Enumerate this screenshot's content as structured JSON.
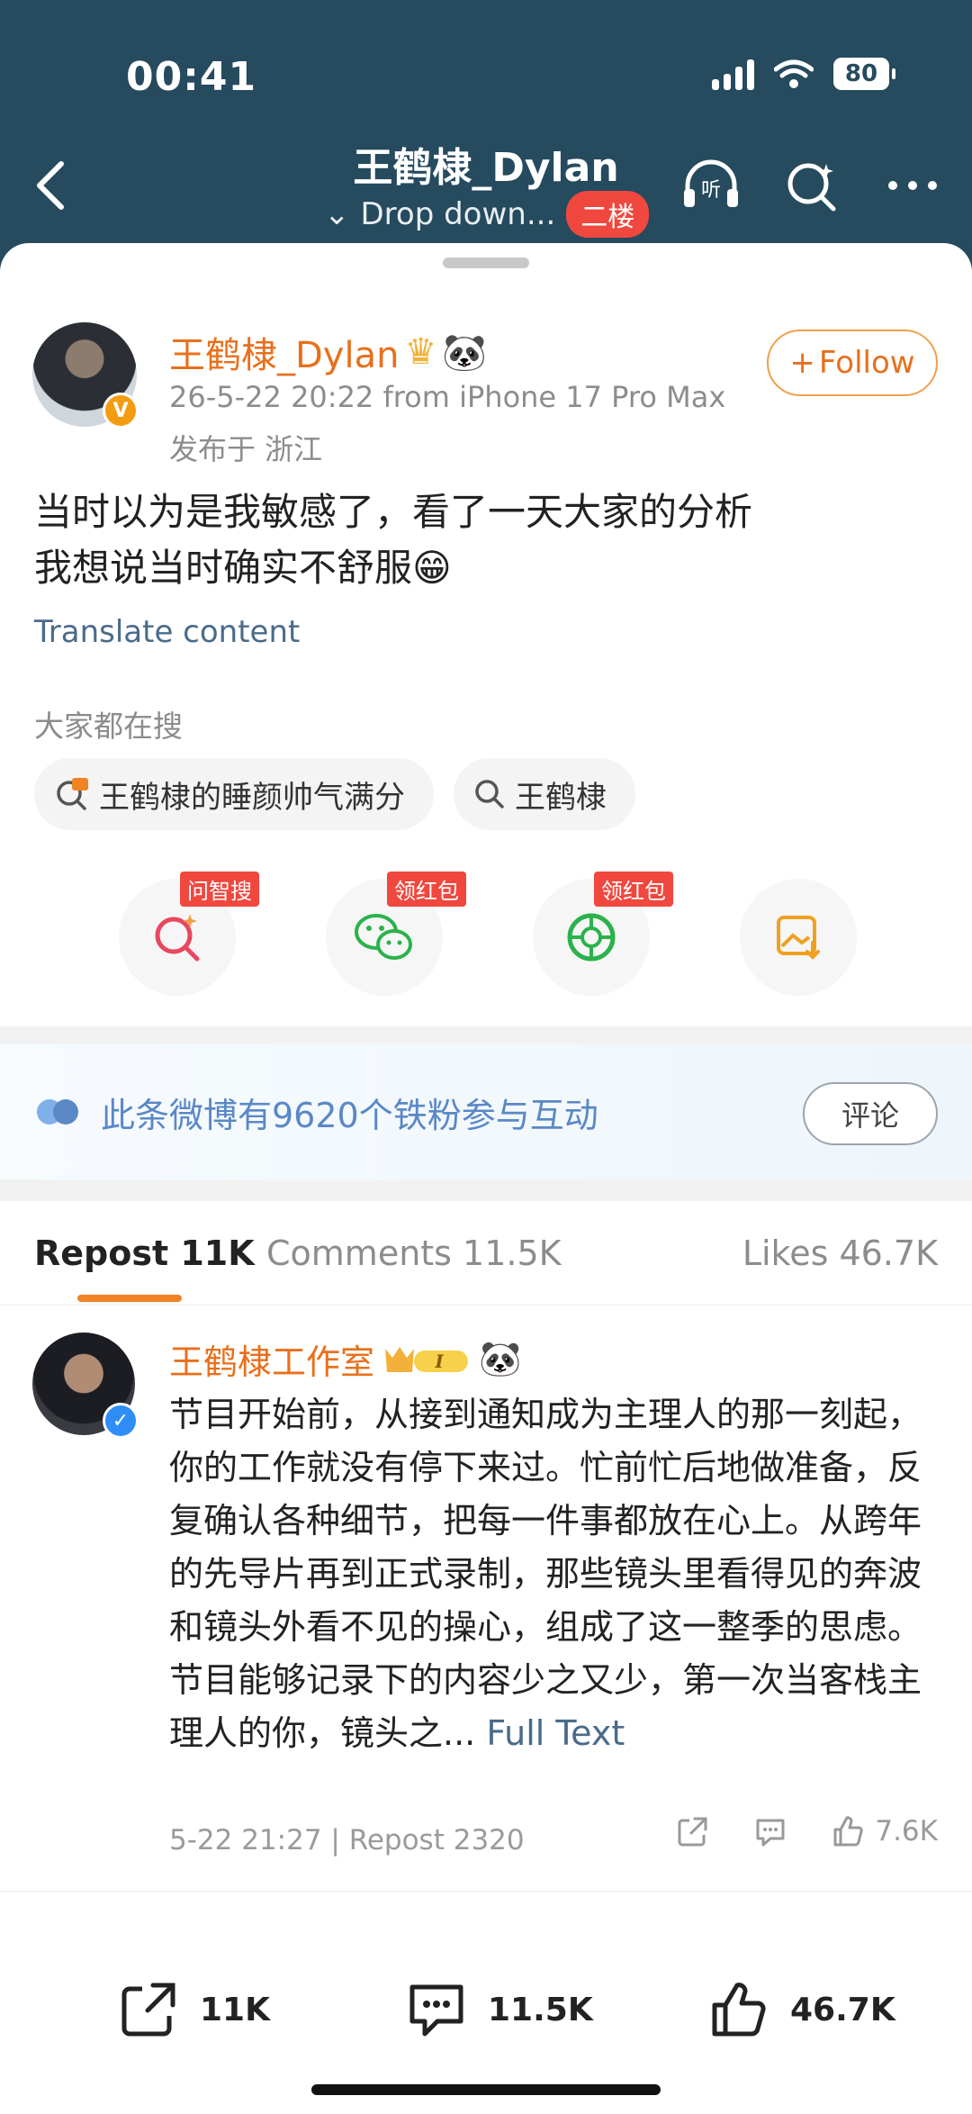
{
  "status": {
    "time": "00:41",
    "battery": "80"
  },
  "nav": {
    "title": "王鹤棣_Dylan",
    "subtitle": "Drop down...",
    "floor_badge": "二楼"
  },
  "post": {
    "author": "王鹤棣_Dylan",
    "timestamp": "26-5-22 20:22  from iPhone 17 Pro Max",
    "location": "发布于 浙江",
    "follow_label": "Follow",
    "text_line1": "当时以为是我敏感了，看了一天大家的分析",
    "text_line2": "我想说当时确实不舒服",
    "translate": "Translate content",
    "search_title": "大家都在搜",
    "chips": [
      "王鹤棣的睡颜帅气满分",
      "王鹤棣"
    ],
    "action_tags": [
      "问智搜",
      "领红包",
      "领红包"
    ]
  },
  "fans": {
    "text": "此条微博有9620个铁粉参与互动",
    "button": "评论"
  },
  "tabs": {
    "repost": "Repost 11K",
    "comments": "Comments 11.5K",
    "likes": "Likes 46.7K"
  },
  "comment": {
    "author": "王鹤棣工作室",
    "body": "节目开始前，从接到通知成为主理人的那一刻起，你的工作就没有停下来过。忙前忙后地做准备，反复确认各种细节，把每一件事都放在心上。从跨年的先导片再到正式录制，那些镜头里看得见的奔波和镜头外看不见的操心，组成了这一整季的思虑。节目能够记录下的内容少之又少，第一次当客栈主理人的你，镜头之...",
    "full_text": "Full Text",
    "meta": "5-22 21:27 | Repost 2320",
    "likes": "7.6K"
  },
  "bottom": {
    "repost": "11K",
    "comments": "11.5K",
    "likes": "46.7K"
  },
  "colors": {
    "header_bg": "#264a5e",
    "accent_orange": "#e8701c",
    "badge_red": "#f0483e",
    "link_blue": "#4a6b8a"
  }
}
